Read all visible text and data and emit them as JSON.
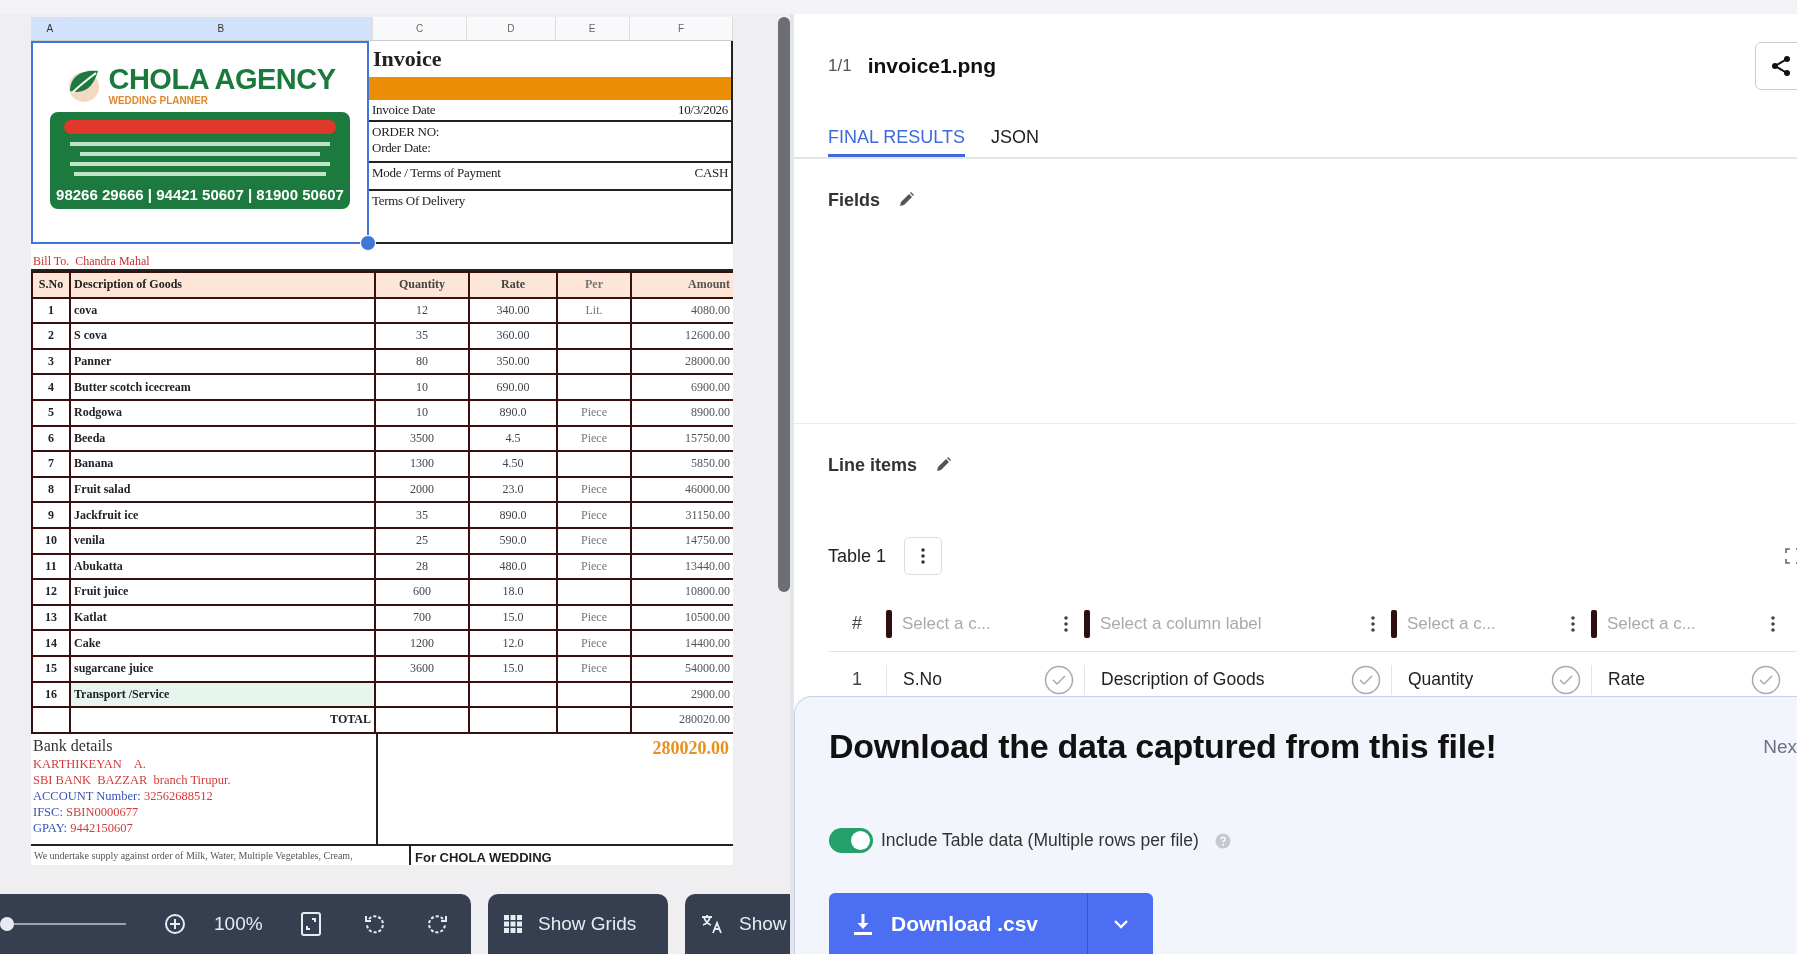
{
  "viewer": {
    "document": {
      "column_letters": [
        {
          "letter": "A",
          "selected": true
        },
        {
          "letter": "B",
          "selected": true
        },
        {
          "letter": "C",
          "selected": false
        },
        {
          "letter": "D",
          "selected": false
        },
        {
          "letter": "E",
          "selected": false
        },
        {
          "letter": "F",
          "selected": false
        }
      ],
      "logo": {
        "name": "CHOLA AGENCY",
        "tagline": "WEDDING PLANNER",
        "phones": "98266 29666 | 94421 50607 | 81900 50607"
      },
      "title": "Invoice",
      "info_rows": [
        {
          "lines": [
            "Invoice Date"
          ],
          "value": "10/3/2026"
        },
        {
          "lines": [
            "ORDER NO:",
            "Order Date:"
          ]
        },
        {
          "lines": [
            "Mode / Terms of Payment"
          ],
          "value": "CASH"
        },
        {
          "lines": [
            "Terms Of Delivery"
          ]
        }
      ],
      "bill_to": "Bill To.  Chandra Mahal",
      "columns": [
        "S.No",
        "Description of Goods",
        "Quantity",
        "Rate",
        "Per",
        "Amount"
      ],
      "rows": [
        {
          "sno": "1",
          "description": "cova",
          "quantity": "12",
          "rate": "340.00",
          "per": "Lit.",
          "amount": "4080.00"
        },
        {
          "sno": "2",
          "description": "S cova",
          "quantity": "35",
          "rate": "360.00",
          "amount": "12600.00"
        },
        {
          "sno": "3",
          "description": "Panner",
          "quantity": "80",
          "rate": "350.00",
          "amount": "28000.00"
        },
        {
          "sno": "4",
          "description": "Butter scotch icecream",
          "quantity": "10",
          "rate": "690.00",
          "amount": "6900.00"
        },
        {
          "sno": "5",
          "description": "Rodgowa",
          "quantity": "10",
          "rate": "890.0",
          "per": "Piece",
          "amount": "8900.00"
        },
        {
          "sno": "6",
          "description": "Beeda",
          "quantity": "3500",
          "rate": "4.5",
          "per": "Piece",
          "amount": "15750.00"
        },
        {
          "sno": "7",
          "description": "Banana",
          "quantity": "1300",
          "rate": "4.50",
          "amount": "5850.00"
        },
        {
          "sno": "8",
          "description": "Fruit salad",
          "quantity": "2000",
          "rate": "23.0",
          "per": "Piece",
          "amount": "46000.00"
        },
        {
          "sno": "9",
          "description": "Jackfruit ice",
          "quantity": "35",
          "rate": "890.0",
          "per": "Piece",
          "amount": "31150.00"
        },
        {
          "sno": "10",
          "description": "venila",
          "quantity": "25",
          "rate": "590.0",
          "per": "Piece",
          "amount": "14750.00"
        },
        {
          "sno": "11",
          "description": "Abukatta",
          "quantity": "28",
          "rate": "480.0",
          "per": "Piece",
          "amount": "13440.00"
        },
        {
          "sno": "12",
          "description": "Fruit juice",
          "quantity": "600",
          "rate": "18.0",
          "amount": "10800.00"
        },
        {
          "sno": "13",
          "description": "Katlat",
          "quantity": "700",
          "rate": "15.0",
          "per": "Piece",
          "amount": "10500.00"
        },
        {
          "sno": "14",
          "description": "Cake",
          "quantity": "1200",
          "rate": "12.0",
          "per": "Piece",
          "amount": "14400.00"
        },
        {
          "sno": "15",
          "description": "sugarcane juice",
          "quantity": "3600",
          "rate": "15.0",
          "per": "Piece",
          "amount": "54000.00"
        },
        {
          "sno": "16",
          "description": "Transport /Service",
          "amount": "2900.00",
          "highlighted": true
        }
      ],
      "total": {
        "label": "TOTAL",
        "amount": "280020.00"
      },
      "bank": {
        "heading": "Bank details",
        "lines": [
          {
            "kind": "plain",
            "text": "KARTHIKEYAN    A."
          },
          {
            "kind": "plain",
            "text": "SBI BANK  BAZZAR  branch Tirupur."
          },
          {
            "kind": "labeled",
            "label": "ACCOUNT Number:",
            "value": "32562688512"
          },
          {
            "kind": "labeled",
            "label": "IFSC:",
            "value": "SBIN0000677"
          },
          {
            "kind": "labeled",
            "label": "GPAY:",
            "value": "9442150607"
          }
        ]
      },
      "grand_total": "280020.00",
      "footer_note": "We undertake supply against order of Milk, Water, Multiple Vegetables, Cream,",
      "signature": "For CHOLA WEDDING"
    },
    "toolbar": {
      "zoom": {
        "level": 0
      },
      "zoom_value": "100%",
      "show_grids": "Show Grids",
      "translate": "Show"
    }
  },
  "results": {
    "file_counter": "1/1",
    "file_name": "invoice1.png",
    "tabs": [
      {
        "label": "FINAL RESULTS",
        "selected": true
      },
      {
        "label": "JSON",
        "selected": false
      }
    ],
    "fields": {
      "title": "Fields"
    },
    "line_items": {
      "title": "Line items",
      "table_title": "Table 1",
      "index_header": "#",
      "columns": [
        {
          "placeholder": "Select a c..."
        },
        {
          "placeholder": "Select a column label"
        },
        {
          "placeholder": "Select a c..."
        },
        {
          "placeholder": "Select a c..."
        }
      ],
      "rows": [
        {
          "index": "1",
          "cells": [
            "S.No",
            "Description of Goods",
            "Quantity",
            "Rate"
          ]
        }
      ]
    },
    "download": {
      "heading": "Download the data captured from this file!",
      "next": "Nex",
      "toggle": {
        "label": "Include Table data (Multiple rows per file)",
        "on": true
      },
      "button": "Download .csv"
    }
  }
}
